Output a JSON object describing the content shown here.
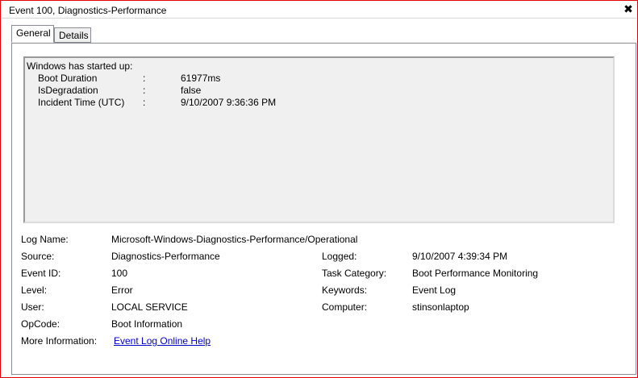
{
  "window": {
    "title": "Event 100, Diagnostics-Performance",
    "close_glyph": "✖"
  },
  "tabs": [
    {
      "label": "General"
    },
    {
      "label": "Details"
    }
  ],
  "description": {
    "header": "Windows has started up:",
    "rows": [
      {
        "key": "Boot Duration",
        "sep": ":",
        "value": "61977ms"
      },
      {
        "key": "IsDegradation",
        "sep": ":",
        "value": "false"
      },
      {
        "key": "Incident Time (UTC)",
        "sep": ":",
        "value": "9/10/2007 9:36:36 PM"
      }
    ]
  },
  "properties": {
    "log_name": {
      "label": "Log Name:",
      "value": "Microsoft-Windows-Diagnostics-Performance/Operational"
    },
    "source": {
      "label": "Source:",
      "value": "Diagnostics-Performance"
    },
    "logged": {
      "label": "Logged:",
      "value": "9/10/2007 4:39:34 PM"
    },
    "event_id": {
      "label": "Event ID:",
      "value": "100"
    },
    "task_category": {
      "label": "Task Category:",
      "value": "Boot Performance Monitoring"
    },
    "level": {
      "label": "Level:",
      "value": "Error"
    },
    "keywords": {
      "label": "Keywords:",
      "value": "Event Log"
    },
    "user": {
      "label": "User:",
      "value": "LOCAL SERVICE"
    },
    "computer": {
      "label": "Computer:",
      "value": "stinsonlaptop"
    },
    "opcode": {
      "label": "OpCode:",
      "value": "Boot Information"
    },
    "more_info": {
      "label": "More Information:",
      "link_text": "Event Log Online Help"
    }
  }
}
